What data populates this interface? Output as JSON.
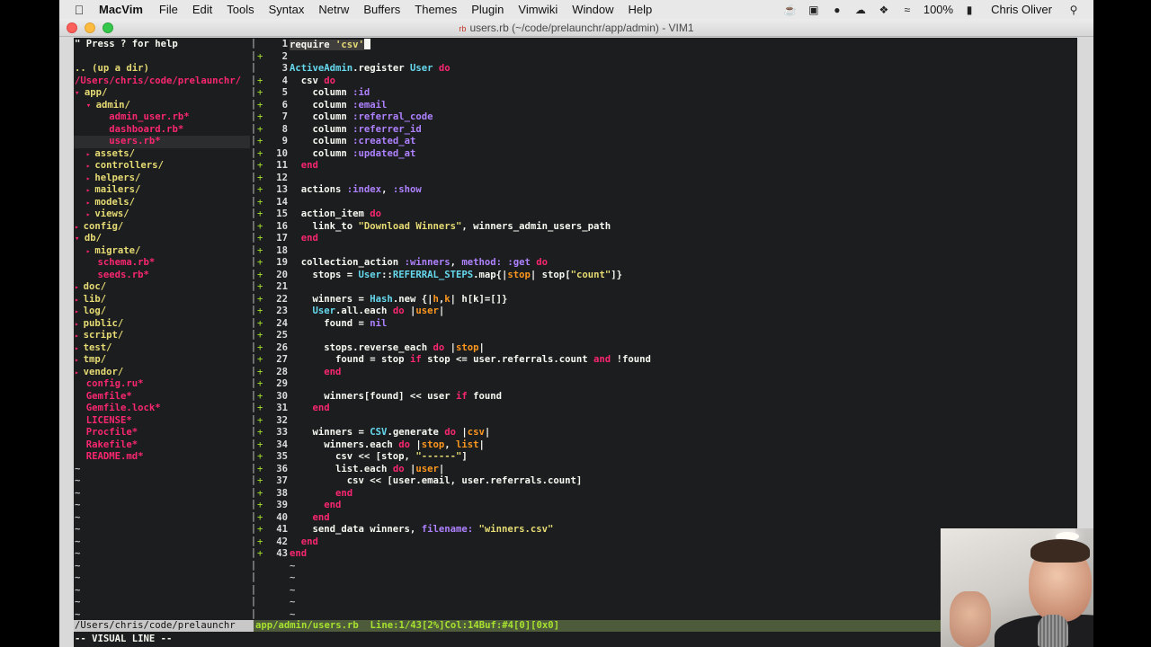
{
  "menubar": {
    "app": "MacVim",
    "items": [
      "File",
      "Edit",
      "Tools",
      "Syntax",
      "Netrw",
      "Buffers",
      "Themes",
      "Plugin",
      "Vimwiki",
      "Window",
      "Help"
    ],
    "battery": "100%",
    "user": "Chris Oliver"
  },
  "window": {
    "title": "users.rb (~/code/prelaunchr/app/admin) - VIM1",
    "file_badge": "rb"
  },
  "tree": {
    "help": "\" Press ? for help",
    "up": ".. (up a dir)",
    "root": "/Users/chris/code/prelaunchr/",
    "tilde": "~",
    "entries": [
      {
        "indent": 0,
        "arrow": "open",
        "label": "app/",
        "kind": "dir"
      },
      {
        "indent": 1,
        "arrow": "open",
        "label": "admin/",
        "kind": "dir"
      },
      {
        "indent": 2,
        "arrow": "",
        "label": "admin_user.rb*",
        "kind": "file"
      },
      {
        "indent": 2,
        "arrow": "",
        "label": "dashboard.rb*",
        "kind": "file"
      },
      {
        "indent": 2,
        "arrow": "",
        "label": "users.rb*",
        "kind": "file",
        "selected": true
      },
      {
        "indent": 1,
        "arrow": "closed",
        "label": "assets/",
        "kind": "dir"
      },
      {
        "indent": 1,
        "arrow": "closed",
        "label": "controllers/",
        "kind": "dir"
      },
      {
        "indent": 1,
        "arrow": "closed",
        "label": "helpers/",
        "kind": "dir"
      },
      {
        "indent": 1,
        "arrow": "closed",
        "label": "mailers/",
        "kind": "dir"
      },
      {
        "indent": 1,
        "arrow": "closed",
        "label": "models/",
        "kind": "dir"
      },
      {
        "indent": 1,
        "arrow": "closed",
        "label": "views/",
        "kind": "dir"
      },
      {
        "indent": 0,
        "arrow": "closed",
        "label": "config/",
        "kind": "dir"
      },
      {
        "indent": 0,
        "arrow": "open",
        "label": "db/",
        "kind": "dir"
      },
      {
        "indent": 1,
        "arrow": "closed",
        "label": "migrate/",
        "kind": "dir"
      },
      {
        "indent": 1,
        "arrow": "",
        "label": "schema.rb*",
        "kind": "file"
      },
      {
        "indent": 1,
        "arrow": "",
        "label": "seeds.rb*",
        "kind": "file"
      },
      {
        "indent": 0,
        "arrow": "closed",
        "label": "doc/",
        "kind": "dir"
      },
      {
        "indent": 0,
        "arrow": "closed",
        "label": "lib/",
        "kind": "dir"
      },
      {
        "indent": 0,
        "arrow": "closed",
        "label": "log/",
        "kind": "dir"
      },
      {
        "indent": 0,
        "arrow": "closed",
        "label": "public/",
        "kind": "dir"
      },
      {
        "indent": 0,
        "arrow": "closed",
        "label": "script/",
        "kind": "dir"
      },
      {
        "indent": 0,
        "arrow": "closed",
        "label": "test/",
        "kind": "dir"
      },
      {
        "indent": 0,
        "arrow": "closed",
        "label": "tmp/",
        "kind": "dir"
      },
      {
        "indent": 0,
        "arrow": "closed",
        "label": "vendor/",
        "kind": "dir"
      },
      {
        "indent": 0,
        "arrow": "",
        "label": "config.ru*",
        "kind": "file"
      },
      {
        "indent": 0,
        "arrow": "",
        "label": "Gemfile*",
        "kind": "file"
      },
      {
        "indent": 0,
        "arrow": "",
        "label": "Gemfile.lock*",
        "kind": "file"
      },
      {
        "indent": 0,
        "arrow": "",
        "label": "LICENSE*",
        "kind": "file"
      },
      {
        "indent": 0,
        "arrow": "",
        "label": "Procfile*",
        "kind": "file"
      },
      {
        "indent": 0,
        "arrow": "",
        "label": "Rakefile*",
        "kind": "file"
      },
      {
        "indent": 0,
        "arrow": "",
        "label": "README.md*",
        "kind": "file"
      }
    ]
  },
  "editor": {
    "split_markers": [
      "|~",
      "|+",
      "|",
      "|+",
      "|",
      "|",
      "|",
      "|",
      "|",
      "|",
      "|",
      "|",
      "|",
      "|~",
      "|",
      "|",
      "|",
      "|",
      "|",
      "|",
      "|",
      "|",
      "|",
      "|",
      "|",
      "|",
      "|",
      "|",
      "|",
      "|",
      "|",
      "|",
      "|",
      "|",
      "|",
      "|",
      "|",
      "|",
      "|",
      "|",
      "|",
      "|",
      "|"
    ],
    "signs": [
      "",
      "+",
      "",
      "+",
      "+",
      "+",
      "+",
      "+",
      "+",
      "+",
      "+",
      "+",
      "+",
      "+",
      "+",
      "+",
      "+",
      "+",
      "+",
      "+",
      "+",
      "+",
      "+",
      "+",
      "+",
      "+",
      "+",
      "+",
      "+",
      "+",
      "+",
      "+",
      "+",
      "+",
      "+",
      "+",
      "+",
      "+",
      "+",
      "+",
      "+",
      "+",
      "+"
    ],
    "tilde": "~",
    "lines": [
      [
        {
          "t": "require ",
          "c": "w",
          "vis": true
        },
        {
          "t": "'csv'",
          "c": "s",
          "vis": true
        }
      ],
      [],
      [
        {
          "t": "ActiveAdmin",
          "c": "c"
        },
        {
          "t": ".register ",
          "c": "w"
        },
        {
          "t": "User",
          "c": "c"
        },
        {
          "t": " do",
          "c": "k"
        }
      ],
      [
        {
          "t": "  csv ",
          "c": "w"
        },
        {
          "t": "do",
          "c": "k"
        }
      ],
      [
        {
          "t": "    column ",
          "c": "w"
        },
        {
          "t": ":id",
          "c": "y"
        }
      ],
      [
        {
          "t": "    column ",
          "c": "w"
        },
        {
          "t": ":email",
          "c": "y"
        }
      ],
      [
        {
          "t": "    column ",
          "c": "w"
        },
        {
          "t": ":referral_code",
          "c": "y"
        }
      ],
      [
        {
          "t": "    column ",
          "c": "w"
        },
        {
          "t": ":referrer_id",
          "c": "y"
        }
      ],
      [
        {
          "t": "    column ",
          "c": "w"
        },
        {
          "t": ":created_at",
          "c": "y"
        }
      ],
      [
        {
          "t": "    column ",
          "c": "w"
        },
        {
          "t": ":updated_at",
          "c": "y"
        }
      ],
      [
        {
          "t": "  end",
          "c": "k"
        }
      ],
      [],
      [
        {
          "t": "  actions ",
          "c": "w"
        },
        {
          "t": ":index",
          "c": "y"
        },
        {
          "t": ", ",
          "c": "w"
        },
        {
          "t": ":show",
          "c": "y"
        }
      ],
      [],
      [
        {
          "t": "  action_item ",
          "c": "w"
        },
        {
          "t": "do",
          "c": "k"
        }
      ],
      [
        {
          "t": "    link_to ",
          "c": "w"
        },
        {
          "t": "\"Download Winners\"",
          "c": "s"
        },
        {
          "t": ", winners_admin_users_path",
          "c": "w"
        }
      ],
      [
        {
          "t": "  end",
          "c": "k"
        }
      ],
      [],
      [
        {
          "t": "  collection_action ",
          "c": "w"
        },
        {
          "t": ":winners",
          "c": "y"
        },
        {
          "t": ", ",
          "c": "w"
        },
        {
          "t": "method:",
          "c": "y"
        },
        {
          "t": " ",
          "c": "w"
        },
        {
          "t": ":get",
          "c": "y"
        },
        {
          "t": " do",
          "c": "k"
        }
      ],
      [
        {
          "t": "    stops = ",
          "c": "w"
        },
        {
          "t": "User",
          "c": "c"
        },
        {
          "t": "::",
          "c": "w"
        },
        {
          "t": "REFERRAL_STEPS",
          "c": "c"
        },
        {
          "t": ".map{|",
          "c": "w"
        },
        {
          "t": "stop",
          "c": "v"
        },
        {
          "t": "| stop[",
          "c": "w"
        },
        {
          "t": "\"count\"",
          "c": "s"
        },
        {
          "t": "]}",
          "c": "w"
        }
      ],
      [],
      [
        {
          "t": "    winners = ",
          "c": "w"
        },
        {
          "t": "Hash",
          "c": "c"
        },
        {
          "t": ".new {|",
          "c": "w"
        },
        {
          "t": "h",
          "c": "v"
        },
        {
          "t": ",",
          "c": "w"
        },
        {
          "t": "k",
          "c": "v"
        },
        {
          "t": "| h[k]=[]}",
          "c": "w"
        }
      ],
      [
        {
          "t": "    ",
          "c": "w"
        },
        {
          "t": "User",
          "c": "c"
        },
        {
          "t": ".all.each ",
          "c": "w"
        },
        {
          "t": "do",
          "c": "k"
        },
        {
          "t": " |",
          "c": "w"
        },
        {
          "t": "user",
          "c": "v"
        },
        {
          "t": "|",
          "c": "w"
        }
      ],
      [
        {
          "t": "      found = ",
          "c": "w"
        },
        {
          "t": "nil",
          "c": "y"
        }
      ],
      [],
      [
        {
          "t": "      stops.reverse_each ",
          "c": "w"
        },
        {
          "t": "do",
          "c": "k"
        },
        {
          "t": " |",
          "c": "w"
        },
        {
          "t": "stop",
          "c": "v"
        },
        {
          "t": "|",
          "c": "w"
        }
      ],
      [
        {
          "t": "        found = stop ",
          "c": "w"
        },
        {
          "t": "if",
          "c": "k"
        },
        {
          "t": " stop <= user.referrals.count ",
          "c": "w"
        },
        {
          "t": "and",
          "c": "k"
        },
        {
          "t": " !found",
          "c": "w"
        }
      ],
      [
        {
          "t": "      end",
          "c": "k"
        }
      ],
      [],
      [
        {
          "t": "      winners[found] << user ",
          "c": "w"
        },
        {
          "t": "if",
          "c": "k"
        },
        {
          "t": " found",
          "c": "w"
        }
      ],
      [
        {
          "t": "    end",
          "c": "k"
        }
      ],
      [],
      [
        {
          "t": "    winners = ",
          "c": "w"
        },
        {
          "t": "CSV",
          "c": "c"
        },
        {
          "t": ".generate ",
          "c": "w"
        },
        {
          "t": "do",
          "c": "k"
        },
        {
          "t": " |",
          "c": "w"
        },
        {
          "t": "csv",
          "c": "v"
        },
        {
          "t": "|",
          "c": "w"
        }
      ],
      [
        {
          "t": "      winners.each ",
          "c": "w"
        },
        {
          "t": "do",
          "c": "k"
        },
        {
          "t": " |",
          "c": "w"
        },
        {
          "t": "stop",
          "c": "v"
        },
        {
          "t": ", ",
          "c": "w"
        },
        {
          "t": "list",
          "c": "v"
        },
        {
          "t": "|",
          "c": "w"
        }
      ],
      [
        {
          "t": "        csv << [stop, ",
          "c": "w"
        },
        {
          "t": "\"------\"",
          "c": "s"
        },
        {
          "t": "]",
          "c": "w"
        }
      ],
      [
        {
          "t": "        list.each ",
          "c": "w"
        },
        {
          "t": "do",
          "c": "k"
        },
        {
          "t": " |",
          "c": "w"
        },
        {
          "t": "user",
          "c": "v"
        },
        {
          "t": "|",
          "c": "w"
        }
      ],
      [
        {
          "t": "          csv << [user.email, user.referrals.count]",
          "c": "w"
        }
      ],
      [
        {
          "t": "        end",
          "c": "k"
        }
      ],
      [
        {
          "t": "      end",
          "c": "k"
        }
      ],
      [
        {
          "t": "    end",
          "c": "k"
        }
      ],
      [
        {
          "t": "    send_data winners, ",
          "c": "w"
        },
        {
          "t": "filename:",
          "c": "y"
        },
        {
          "t": " ",
          "c": "w"
        },
        {
          "t": "\"winners.csv\"",
          "c": "s"
        }
      ],
      [
        {
          "t": "  end",
          "c": "k"
        }
      ],
      [
        {
          "t": "end",
          "c": "k"
        }
      ]
    ]
  },
  "statusline": {
    "left": "/Users/chris/code/prelaunchr",
    "right": "app/admin/users.rb  Line:1/43[2%]Col:14Buf:#4[0][0x0]"
  },
  "mode": "-- VISUAL LINE --",
  "colors": {
    "keyword": "#f92672",
    "constant": "#66d9ef",
    "string": "#e6db74",
    "symbol": "#ae81ff",
    "block_var": "#fd971f",
    "git_added": "#a6e22e",
    "background": "#1b1d1e"
  }
}
